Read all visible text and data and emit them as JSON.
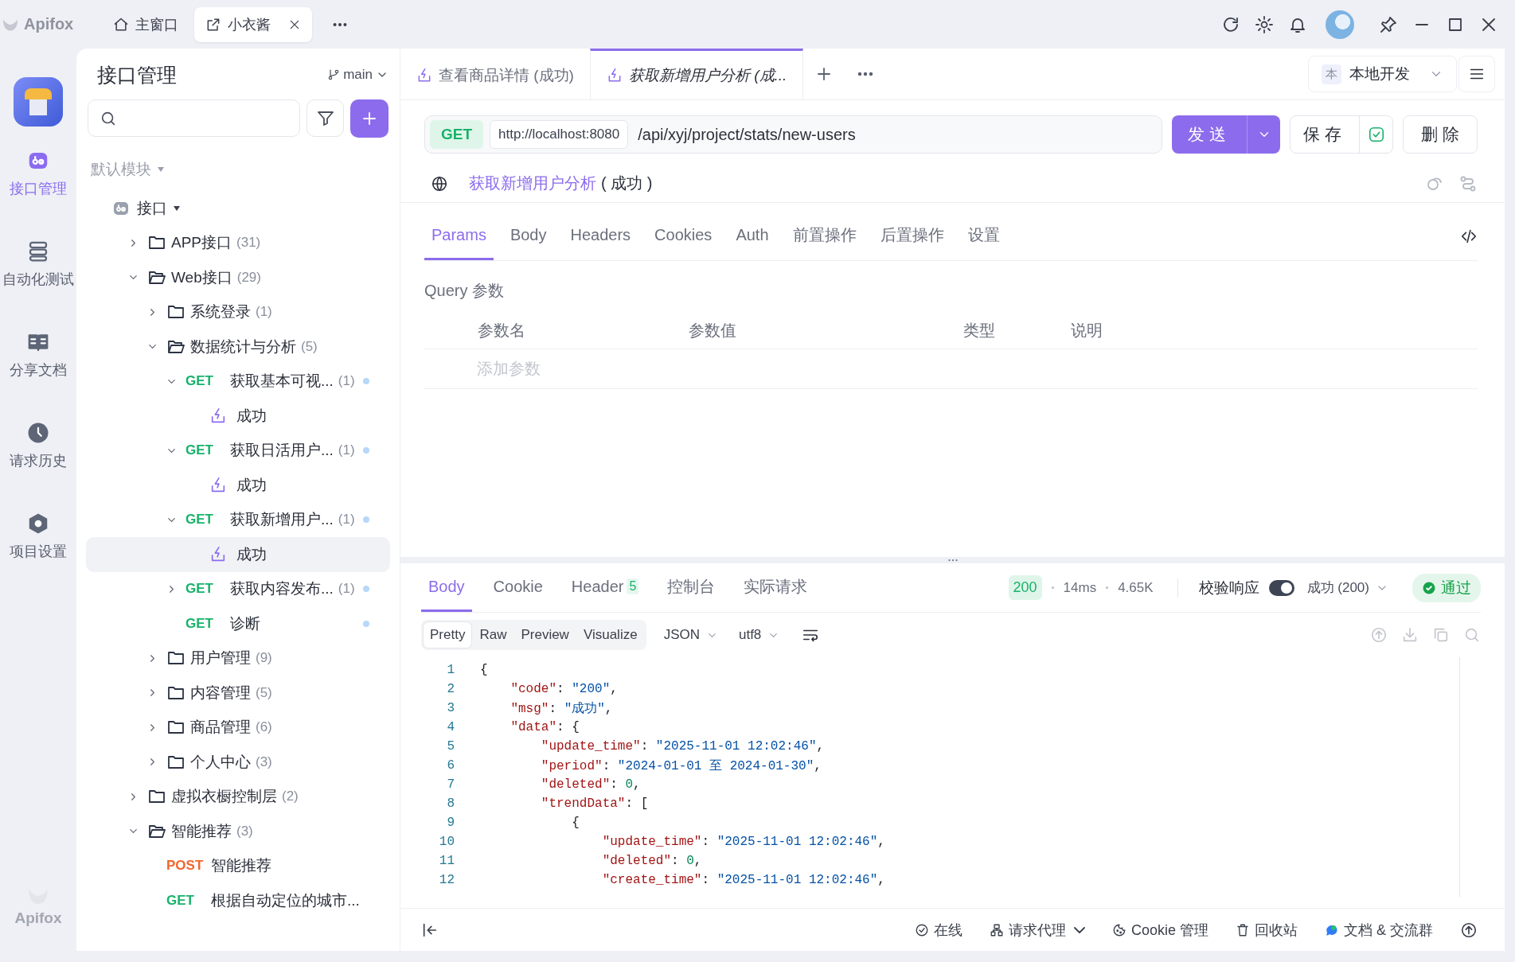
{
  "app": {
    "name": "Apifox"
  },
  "window_tabs": [
    {
      "label": "主窗口",
      "kind": "home",
      "selected": false,
      "closable": false
    },
    {
      "label": "小衣酱",
      "kind": "project",
      "selected": true,
      "closable": true
    }
  ],
  "rail": [
    {
      "label": "接口管理",
      "selected": true
    },
    {
      "label": "自动化测试",
      "selected": false
    },
    {
      "label": "分享文档",
      "selected": false
    },
    {
      "label": "请求历史",
      "selected": false
    },
    {
      "label": "项目设置",
      "selected": false
    }
  ],
  "rail_footer": "Apifox",
  "tree_panel": {
    "title": "接口管理",
    "branch": "main",
    "module": "默认模块",
    "root": "接口",
    "items": [
      {
        "kind": "folder",
        "label": "APP接口",
        "count": "(31)",
        "expanded": false,
        "selected": false
      },
      {
        "kind": "folder",
        "label": "Web接口",
        "count": "(29)",
        "expanded": true,
        "selected": false,
        "children": [
          {
            "kind": "folder",
            "label": "系统登录",
            "count": "(1)",
            "expanded": false,
            "selected": false
          },
          {
            "kind": "folder",
            "label": "数据统计与分析",
            "count": "(5)",
            "expanded": true,
            "selected": false,
            "children": [
              {
                "kind": "api",
                "method": "GET",
                "label": "获取基本可视...",
                "count": "(1)",
                "dot": true,
                "expanded": true,
                "selected": false,
                "children": [
                  {
                    "kind": "case",
                    "label": "成功",
                    "selected": false
                  }
                ]
              },
              {
                "kind": "api",
                "method": "GET",
                "label": "获取日活用户...",
                "count": "(1)",
                "dot": true,
                "expanded": true,
                "selected": false,
                "children": [
                  {
                    "kind": "case",
                    "label": "成功",
                    "selected": false
                  }
                ]
              },
              {
                "kind": "api",
                "method": "GET",
                "label": "获取新增用户...",
                "count": "(1)",
                "dot": true,
                "expanded": true,
                "selected": false,
                "children": [
                  {
                    "kind": "case",
                    "label": "成功",
                    "selected": true
                  }
                ]
              },
              {
                "kind": "api",
                "method": "GET",
                "label": "获取内容发布...",
                "count": "(1)",
                "dot": true,
                "expanded": false,
                "selected": false
              },
              {
                "kind": "api",
                "method": "GET",
                "label": "诊断",
                "dot": true,
                "selected": false
              }
            ]
          },
          {
            "kind": "folder",
            "label": "用户管理",
            "count": "(9)",
            "expanded": false,
            "selected": false
          },
          {
            "kind": "folder",
            "label": "内容管理",
            "count": "(5)",
            "expanded": false,
            "selected": false
          },
          {
            "kind": "folder",
            "label": "商品管理",
            "count": "(6)",
            "expanded": false,
            "selected": false
          },
          {
            "kind": "folder",
            "label": "个人中心",
            "count": "(3)",
            "expanded": false,
            "selected": false
          }
        ]
      },
      {
        "kind": "folder",
        "label": "虚拟衣橱控制层",
        "count": "(2)",
        "expanded": false,
        "selected": false
      },
      {
        "kind": "folder",
        "label": "智能推荐",
        "count": "(3)",
        "expanded": true,
        "selected": false,
        "children": [
          {
            "kind": "api",
            "method": "POST",
            "label": "智能推荐",
            "dot": false,
            "selected": false
          },
          {
            "kind": "api",
            "method": "GET",
            "label": "根据自动定位的城市...",
            "dot": false,
            "selected": false
          }
        ]
      }
    ]
  },
  "request_tabs": [
    {
      "label": "查看商品详情 (成功)",
      "selected": false
    },
    {
      "label": "获取新增用户分析 (成...",
      "selected": true
    }
  ],
  "environment": {
    "badge": "本",
    "label": "本地开发"
  },
  "request": {
    "method": "GET",
    "base_url": "http://localhost:8080",
    "path": "/api/xyj/project/stats/new-users",
    "send": "发送",
    "save": "保存",
    "saved": true,
    "delete": "删除",
    "name": "获取新增用户分析",
    "suffix": "( 成功 )"
  },
  "param_tabs": [
    {
      "label": "Params",
      "selected": true
    },
    {
      "label": "Body",
      "selected": false
    },
    {
      "label": "Headers",
      "selected": false
    },
    {
      "label": "Cookies",
      "selected": false
    },
    {
      "label": "Auth",
      "selected": false
    },
    {
      "label": "前置操作",
      "selected": false
    },
    {
      "label": "后置操作",
      "selected": false
    },
    {
      "label": "设置",
      "selected": false
    }
  ],
  "query": {
    "title": "Query 参数",
    "columns": [
      "参数名",
      "参数值",
      "类型",
      "说明"
    ],
    "placeholder": "添加参数"
  },
  "response": {
    "tabs": [
      {
        "label": "Body",
        "selected": true
      },
      {
        "label": "Cookie",
        "selected": false
      },
      {
        "label": "Header",
        "badge": "5",
        "selected": false
      },
      {
        "label": "控制台",
        "selected": false
      },
      {
        "label": "实际请求",
        "selected": false
      }
    ],
    "status": "200",
    "time": "14ms",
    "size": "4.65K",
    "validate_label": "校验响应",
    "validate_on": true,
    "validate_target": "成功 (200)",
    "result": "通过",
    "views": [
      {
        "label": "Pretty",
        "selected": true
      },
      {
        "label": "Raw",
        "selected": false
      },
      {
        "label": "Preview",
        "selected": false
      },
      {
        "label": "Visualize",
        "selected": false
      }
    ],
    "format": "JSON",
    "encoding": "utf8",
    "lines": [
      {
        "number": "1",
        "text": "{"
      },
      {
        "number": "2",
        "text": "    \"code\": \"200\","
      },
      {
        "number": "3",
        "text": "    \"msg\": \"成功\","
      },
      {
        "number": "4",
        "text": "    \"data\": {"
      },
      {
        "number": "5",
        "text": "        \"update_time\": \"2025-11-01 12:02:46\","
      },
      {
        "number": "6",
        "text": "        \"period\": \"2024-01-01 至 2024-01-30\","
      },
      {
        "number": "7",
        "text": "        \"deleted\": 0,"
      },
      {
        "number": "8",
        "text": "        \"trendData\": ["
      },
      {
        "number": "9",
        "text": "            {"
      },
      {
        "number": "10",
        "text": "                \"update_time\": \"2025-11-01 12:02:46\","
      },
      {
        "number": "11",
        "text": "                \"deleted\": 0,"
      },
      {
        "number": "12",
        "text": "                \"create_time\": \"2025-11-01 12:02:46\","
      }
    ]
  },
  "status_bar": [
    {
      "label": "在线",
      "dropdown": false
    },
    {
      "label": "请求代理",
      "dropdown": true
    },
    {
      "label": "Cookie 管理",
      "dropdown": false
    },
    {
      "label": "回收站",
      "dropdown": false
    },
    {
      "label": "文档 & 交流群",
      "dropdown": false
    }
  ]
}
